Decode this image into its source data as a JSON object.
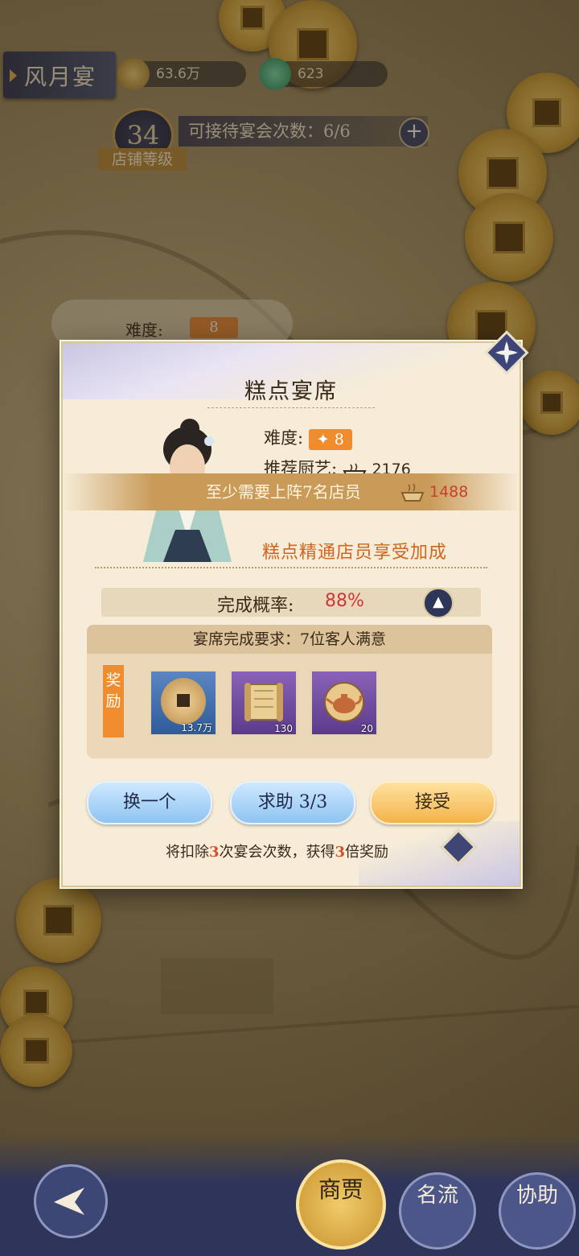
{
  "header": {
    "title": "风月宴",
    "coins": "63.6万",
    "jade": "623"
  },
  "shop": {
    "level": "34",
    "level_label": "店铺等级",
    "banquet_count_label": "可接待宴会次数：6/6"
  },
  "background_card": {
    "difficulty_label": "难度:",
    "difficulty_value": "8"
  },
  "modal": {
    "title": "糕点宴席",
    "difficulty_label": "难度:",
    "difficulty_value": "8",
    "recommended_skill_label": "推荐厨艺:",
    "recommended_skill_value": "2176",
    "staff_requirement": "至少需要上阵7名店员",
    "current_skill_value": "1488",
    "bonus_text": "糕点精通店员享受加成",
    "completion_rate_label": "完成概率:",
    "completion_rate_value": "88%",
    "completion_requirement": "宴席完成要求：7位客人满意",
    "reward_label": "奖励",
    "rewards": [
      {
        "icon": "copper-coin-icon",
        "count": "13.7万"
      },
      {
        "icon": "scroll-icon",
        "count": "130"
      },
      {
        "icon": "teapot-icon",
        "count": "20"
      }
    ],
    "buttons": {
      "swap": "换一个",
      "help": "求助 3/3",
      "accept": "接受"
    },
    "note_prefix": "将扣除",
    "note_num1": "3",
    "note_mid": "次宴会次数，获得",
    "note_num2": "3",
    "note_suffix": "倍奖励"
  },
  "bottom_nav": {
    "main": "商贾",
    "ming_liu": "名流",
    "xie_zhu": "协助"
  }
}
